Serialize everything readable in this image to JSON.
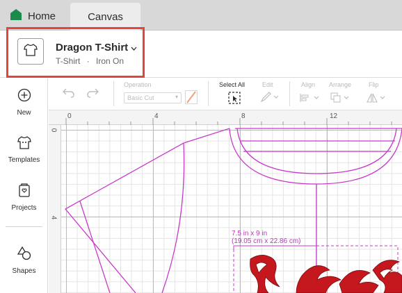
{
  "tabs": {
    "home": "Home",
    "canvas": "Canvas"
  },
  "project": {
    "title": "Dragon T-Shirt",
    "type": "T-Shirt",
    "material": "Iron On",
    "separator": "·"
  },
  "sidebar": {
    "items": [
      {
        "label": "New",
        "icon": "plus-circle-icon"
      },
      {
        "label": "Templates",
        "icon": "tshirt-icon"
      },
      {
        "label": "Projects",
        "icon": "projects-icon"
      },
      {
        "label": "Shapes",
        "icon": "shapes-icon"
      }
    ]
  },
  "toolbar": {
    "operation_label": "Operation",
    "operation_value": "Basic Cut",
    "select_all": "Select All",
    "edit": "Edit",
    "align": "Align",
    "arrange": "Arrange",
    "flip": "Flip"
  },
  "ruler": {
    "top": [
      "0",
      "4",
      "8",
      "12"
    ],
    "left": [
      "0",
      "4"
    ]
  },
  "selection": {
    "size_in": "7.5 in x 9 in",
    "size_cm": "(19.05 cm x 22.86 cm)"
  },
  "colors": {
    "brand": "#1b8a4a",
    "outline": "#c93ac9",
    "dragon": "#c4181e",
    "highlight": "#e0463b"
  }
}
